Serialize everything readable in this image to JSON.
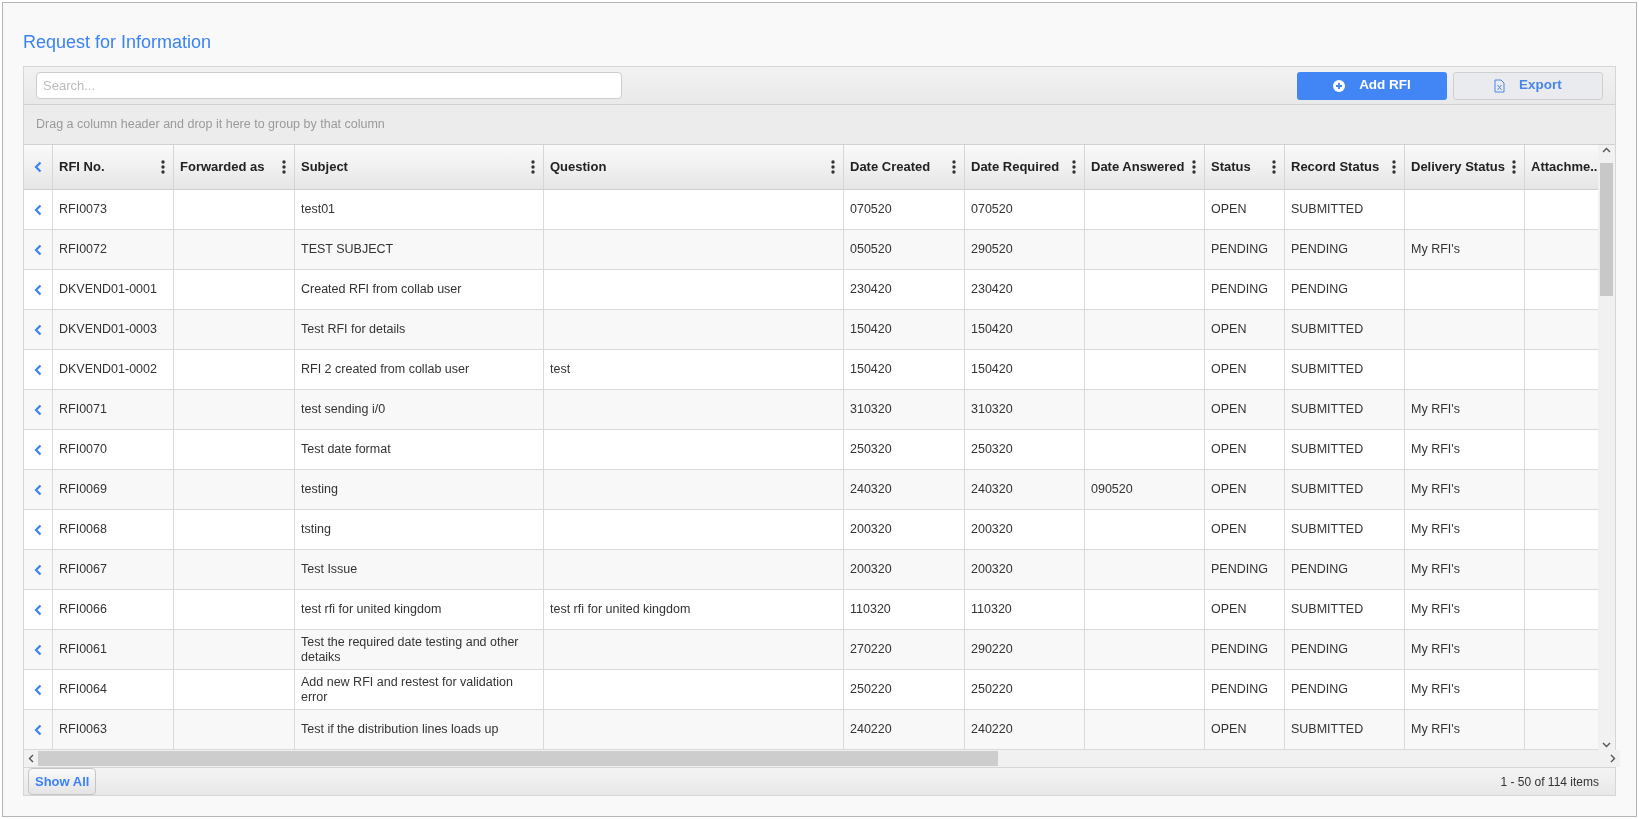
{
  "title": "Request for Information",
  "toolbar": {
    "search": {
      "placeholder": "Search..."
    },
    "buttons": [
      {
        "label": "Add RFI",
        "kind": "primary"
      },
      {
        "label": "Export",
        "kind": "secondary"
      }
    ]
  },
  "group_hint": "Drag a column header and drop it here to group by that column",
  "table": {
    "columns": [
      {
        "label": "RFI No.",
        "menu": true
      },
      {
        "label": "Forwarded as",
        "menu": true
      },
      {
        "label": "Subject",
        "menu": true
      },
      {
        "label": "Question",
        "menu": true
      },
      {
        "label": "Date Created",
        "menu": true
      },
      {
        "label": "Date Required",
        "menu": true
      },
      {
        "label": "Date Answered",
        "menu": true
      },
      {
        "label": "Status",
        "menu": true
      },
      {
        "label": "Record Status",
        "menu": true
      },
      {
        "label": "Delivery Status",
        "menu": true
      },
      {
        "label": "Attachme...",
        "menu": false
      }
    ],
    "rows": [
      {
        "rfi_no": "RFI0073",
        "subject": "test01",
        "date_created": "070520",
        "date_required": "070520",
        "status": "OPEN",
        "record_status": "SUBMITTED"
      },
      {
        "rfi_no": "RFI0072",
        "subject": "TEST SUBJECT",
        "date_created": "050520",
        "date_required": "290520",
        "status": "PENDING",
        "record_status": "PENDING",
        "delivery_status": "My RFI's"
      },
      {
        "rfi_no": "DKVEND01-0001",
        "subject": "Created RFI from collab user",
        "date_created": "230420",
        "date_required": "230420",
        "status": "PENDING",
        "record_status": "PENDING"
      },
      {
        "rfi_no": "DKVEND01-0003",
        "subject": "Test RFI for details",
        "date_created": "150420",
        "date_required": "150420",
        "status": "OPEN",
        "record_status": "SUBMITTED"
      },
      {
        "rfi_no": "DKVEND01-0002",
        "subject": "RFI 2 created from collab user",
        "question": "test",
        "date_created": "150420",
        "date_required": "150420",
        "status": "OPEN",
        "record_status": "SUBMITTED"
      },
      {
        "rfi_no": "RFI0071",
        "subject": "test sending i/0",
        "date_created": "310320",
        "date_required": "310320",
        "status": "OPEN",
        "record_status": "SUBMITTED",
        "delivery_status": "My RFI's"
      },
      {
        "rfi_no": "RFI0070",
        "subject": "Test date format",
        "date_created": "250320",
        "date_required": "250320",
        "status": "OPEN",
        "record_status": "SUBMITTED",
        "delivery_status": "My RFI's"
      },
      {
        "rfi_no": "RFI0069",
        "subject": "testing",
        "date_created": "240320",
        "date_required": "240320",
        "date_answered": "090520",
        "status": "OPEN",
        "record_status": "SUBMITTED",
        "delivery_status": "My RFI's"
      },
      {
        "rfi_no": "RFI0068",
        "subject": "tsting",
        "date_created": "200320",
        "date_required": "200320",
        "status": "OPEN",
        "record_status": "SUBMITTED",
        "delivery_status": "My RFI's"
      },
      {
        "rfi_no": "RFI0067",
        "subject": "Test Issue",
        "date_created": "200320",
        "date_required": "200320",
        "status": "PENDING",
        "record_status": "PENDING",
        "delivery_status": "My RFI's"
      },
      {
        "rfi_no": "RFI0066",
        "subject": "test rfi for united kingdom",
        "question": "test rfi for united kingdom",
        "date_created": "110320",
        "date_required": "110320",
        "status": "OPEN",
        "record_status": "SUBMITTED",
        "delivery_status": "My RFI's"
      },
      {
        "rfi_no": "RFI0061",
        "subject": "Test the required date testing and other detaiks",
        "date_created": "270220",
        "date_required": "290220",
        "status": "PENDING",
        "record_status": "PENDING",
        "delivery_status": "My RFI's"
      },
      {
        "rfi_no": "RFI0064",
        "subject": "Add new RFI and restest for validation error",
        "date_created": "250220",
        "date_required": "250220",
        "status": "PENDING",
        "record_status": "PENDING",
        "delivery_status": "My RFI's"
      },
      {
        "rfi_no": "RFI0063",
        "subject": "Test if the distribution lines loads up",
        "date_created": "240220",
        "date_required": "240220",
        "status": "OPEN",
        "record_status": "SUBMITTED",
        "delivery_status": "My RFI's"
      }
    ]
  },
  "footer": {
    "show_all": "Show All",
    "paging": "1 - 50 of 114 items"
  }
}
